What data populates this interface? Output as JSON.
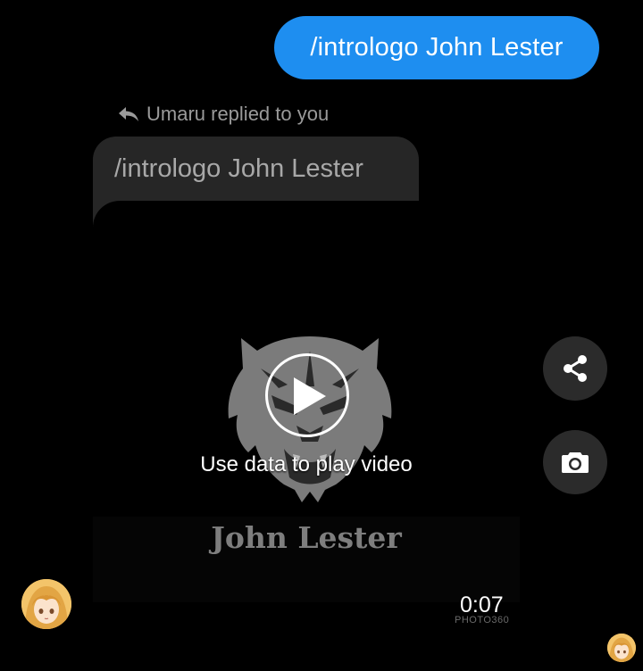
{
  "sent_message": {
    "text": "/intrologo John Lester",
    "color": "#1e8ef0"
  },
  "reply": {
    "header": "Umaru replied to you",
    "icon": "reply-arrow-icon",
    "quoted_text": "/intrologo John Lester"
  },
  "video": {
    "logo_text": "John Lester",
    "play_prompt": "Use data to play video",
    "duration": "0:07",
    "watermark": "PHOTO360",
    "logo_icon": "tiger-head-icon",
    "play_icon": "play-icon"
  },
  "actions": {
    "share_icon": "share-icon",
    "camera_icon": "camera-icon"
  },
  "avatars": {
    "sender_icon": "anime-girl-avatar",
    "seen_icon": "anime-girl-avatar"
  }
}
